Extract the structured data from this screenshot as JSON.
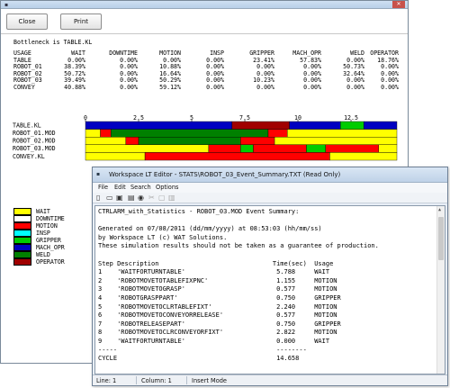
{
  "win1": {
    "close_label": "Close",
    "print_label": "Print",
    "bottleneck": "Bottleneck is TABLE.KL",
    "columns": [
      "USAGE",
      "WAIT",
      "DOWNTIME",
      "MOTION",
      "INSP",
      "GRIPPER",
      "MACH_OPR",
      "WELD",
      "OPERATOR"
    ],
    "rows": [
      [
        "TABLE",
        "0.00%",
        "0.00%",
        "0.00%",
        "0.00%",
        "23.41%",
        "57.83%",
        "0.00%",
        "18.76%"
      ],
      [
        "ROBOT_01",
        "38.39%",
        "0.00%",
        "10.88%",
        "0.00%",
        "0.00%",
        "0.00%",
        "50.73%",
        "0.00%"
      ],
      [
        "ROBOT_02",
        "50.72%",
        "0.00%",
        "16.64%",
        "0.00%",
        "0.00%",
        "0.00%",
        "32.64%",
        "0.00%"
      ],
      [
        "ROBOT_03",
        "39.49%",
        "0.00%",
        "50.29%",
        "0.00%",
        "10.23%",
        "0.00%",
        "0.00%",
        "0.00%"
      ],
      [
        "CONVEY",
        "40.88%",
        "0.00%",
        "59.12%",
        "0.00%",
        "0.00%",
        "0.00%",
        "0.00%",
        "0.00%"
      ]
    ],
    "legend": [
      {
        "label": "WAIT",
        "color": "#ffff00"
      },
      {
        "label": "DOWNTIME",
        "color": "#ffffff"
      },
      {
        "label": "MOTION",
        "color": "#ff0000"
      },
      {
        "label": "INSP",
        "color": "#00ffff"
      },
      {
        "label": "GRIPPER",
        "color": "#00cc00"
      },
      {
        "label": "MACH_OPR",
        "color": "#0000c0"
      },
      {
        "label": "WELD",
        "color": "#008000"
      },
      {
        "label": "OPERATOR",
        "color": "#a00000"
      }
    ]
  },
  "chart_data": {
    "type": "gantt",
    "x_ticks": [
      "0",
      "2.5",
      "5",
      "7.5",
      "10",
      "12.5"
    ],
    "xlim": [
      0,
      14.66
    ],
    "rows": [
      {
        "name": "TABLE.KL",
        "segments": [
          {
            "state": "MACH_OPR",
            "start": 0,
            "end": 6.9
          },
          {
            "state": "OPERATOR",
            "start": 6.9,
            "end": 9.6
          },
          {
            "state": "MACH_OPR",
            "start": 9.6,
            "end": 12.0
          },
          {
            "state": "GRIPPER",
            "start": 12.0,
            "end": 13.1
          },
          {
            "state": "MACH_OPR",
            "start": 13.1,
            "end": 14.66
          }
        ]
      },
      {
        "name": "ROBOT_01.MOD",
        "segments": [
          {
            "state": "WAIT",
            "start": 0,
            "end": 0.7
          },
          {
            "state": "MOTION",
            "start": 0.7,
            "end": 1.2
          },
          {
            "state": "WELD",
            "start": 1.2,
            "end": 8.6
          },
          {
            "state": "MOTION",
            "start": 8.6,
            "end": 9.5
          },
          {
            "state": "WAIT",
            "start": 9.5,
            "end": 14.66
          }
        ]
      },
      {
        "name": "ROBOT_02.MOD",
        "segments": [
          {
            "state": "WAIT",
            "start": 0,
            "end": 1.9
          },
          {
            "state": "MOTION",
            "start": 1.9,
            "end": 2.5
          },
          {
            "state": "WELD",
            "start": 2.5,
            "end": 7.3
          },
          {
            "state": "MOTION",
            "start": 7.3,
            "end": 8.9
          },
          {
            "state": "WAIT",
            "start": 8.9,
            "end": 14.66
          }
        ]
      },
      {
        "name": "ROBOT_03.MOD",
        "segments": [
          {
            "state": "WAIT",
            "start": 0,
            "end": 5.8
          },
          {
            "state": "MOTION",
            "start": 5.8,
            "end": 7.3
          },
          {
            "state": "GRIPPER",
            "start": 7.3,
            "end": 7.9
          },
          {
            "state": "MOTION",
            "start": 7.9,
            "end": 10.4
          },
          {
            "state": "GRIPPER",
            "start": 10.4,
            "end": 11.3
          },
          {
            "state": "MOTION",
            "start": 11.3,
            "end": 13.8
          },
          {
            "state": "WAIT",
            "start": 13.8,
            "end": 14.66
          }
        ]
      },
      {
        "name": "CONVEY.KL",
        "segments": [
          {
            "state": "WAIT",
            "start": 0,
            "end": 2.8
          },
          {
            "state": "MOTION",
            "start": 2.8,
            "end": 11.5
          },
          {
            "state": "WAIT",
            "start": 11.5,
            "end": 14.66
          }
        ]
      }
    ]
  },
  "win2": {
    "title": "Workspace LT Editor - STATS\\ROBOT_03_Event_Summary.TXT (Read Only)",
    "menu": [
      "File",
      "Edit",
      "Search",
      "Options"
    ],
    "lines": [
      "CTRLARM_with_Statistics - ROBOT_03.MOD Event Summary:",
      "",
      "Generated on 07/08/2011 (dd/mm/yyyy) at 08:53:03 (hh/mm/ss)",
      "by Workspace LT (c) WAT Solutions.",
      "These simulation results should not be taken as a guarantee of production.",
      "",
      "Step Description                              Time(sec)  Usage",
      "1    'WAITFORTURNTABLE'                        5.788     WAIT",
      "2    'ROBOTMOVETOTABLEFIXPNC'                  1.155     MOTION",
      "3    'ROBOTMOVETOGRASP'                        0.577     MOTION",
      "4    'ROBOTGRASPPART'                          0.750     GRIPPER",
      "5    'ROBOTMOVETOCLRTABLEFIXT'                 2.240     MOTION",
      "6    'ROBOTMOVETOCONVEYORRELEASE'              0.577     MOTION",
      "7    'ROBOTRELEASEPART'                        0.750     GRIPPER",
      "8    'ROBOTMOVETOCLRCONVEYORFIXT'              2.822     MOTION",
      "9    'WAITFORTURNTABLE'                        0.000     WAIT",
      "-----                                          --------",
      "CYCLE                                          14.658"
    ],
    "status": {
      "line": "Line: 1",
      "column": "Column: 1",
      "mode": "Insert Mode"
    }
  }
}
